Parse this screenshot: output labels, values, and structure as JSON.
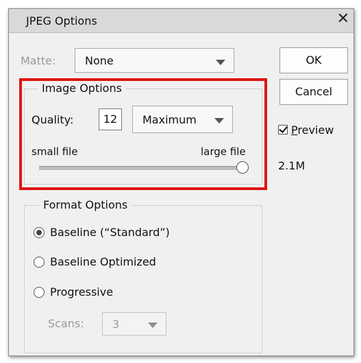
{
  "window": {
    "title": "JPEG Options",
    "close_icon": "close-icon"
  },
  "matte": {
    "label": "Matte:",
    "value": "None",
    "enabled": false
  },
  "buttons": {
    "ok": "OK",
    "cancel": "Cancel"
  },
  "image_options": {
    "title": "Image Options",
    "quality_label": "Quality:",
    "quality_value": "12",
    "quality_preset": "Maximum",
    "small_file_label": "small file",
    "large_file_label": "large file",
    "slider_level_fraction": 1.0
  },
  "preview": {
    "label": "Preview",
    "checked": true,
    "file_size": "2.1M"
  },
  "format_options": {
    "title": "Format Options",
    "options": [
      {
        "label": "Baseline (“Standard”)",
        "selected": true
      },
      {
        "label": "Baseline Optimized",
        "selected": false
      },
      {
        "label": "Progressive",
        "selected": false
      }
    ],
    "scans_label": "Scans:",
    "scans_value": "3",
    "scans_enabled": false
  },
  "colors": {
    "highlight": "#e01414",
    "titlebar": "#d9d9d9",
    "dialog_bg": "#f0f0f0"
  }
}
